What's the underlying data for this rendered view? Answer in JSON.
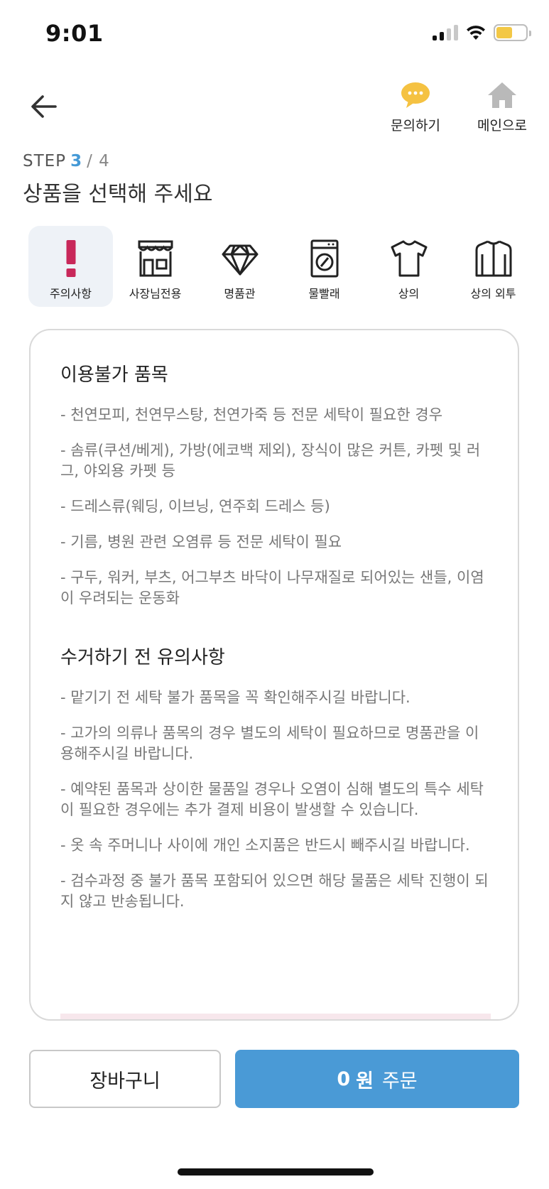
{
  "status": {
    "time": "9:01"
  },
  "nav": {
    "inquiry_label": "문의하기",
    "main_label": "메인으로"
  },
  "step": {
    "prefix": "STEP",
    "current": "3",
    "separator": "/",
    "total": "4",
    "title": "상품을 선택해 주세요"
  },
  "categories": [
    {
      "label": "주의사항",
      "icon": "exclamation-icon",
      "active": true
    },
    {
      "label": "사장님전용",
      "icon": "store-icon",
      "active": false
    },
    {
      "label": "명품관",
      "icon": "diamond-icon",
      "active": false
    },
    {
      "label": "물빨래",
      "icon": "washing-machine-icon",
      "active": false
    },
    {
      "label": "상의",
      "icon": "tshirt-icon",
      "active": false
    },
    {
      "label": "상의 외투",
      "icon": "jacket-icon",
      "active": false
    }
  ],
  "notice": {
    "unavailable": {
      "title": "이용불가 품목",
      "items": [
        "- 천연모피, 천연무스탕, 천연가죽 등 전문 세탁이 필요한 경우",
        "- 솜류(쿠션/베게), 가방(에코백 제외), 장식이 많은 커튼, 카펫 및 러그, 야외용 카펫 등",
        "- 드레스류(웨딩, 이브닝, 연주회 드레스 등)",
        "- 기름, 병원 관련 오염류 등 전문 세탁이 필요",
        "- 구두, 워커, 부츠, 어그부츠 바닥이 나무재질로 되어있는 샌들, 이염이 우려되는 운동화"
      ]
    },
    "precautions": {
      "title": "수거하기 전 유의사항",
      "items": [
        "- 맡기기 전 세탁 불가 품목을 꼭 확인해주시길 바랍니다.",
        "- 고가의 의류나 품목의 경우 별도의 세탁이 필요하므로 명품관을 이용해주시길 바랍니다.",
        "- 예약된 품목과 상이한 물품일 경우나 오염이 심해 별도의 특수 세탁이 필요한 경우에는 추가 결제 비용이 발생할 수 있습니다.",
        "- 옷 속 주머니나 사이에 개인 소지품은 반드시 빼주시길 바랍니다.",
        "- 검수과정 중 불가 품목 포함되어 있으면 해당 물품은 세탁 진행이 되지 않고 반송됩니다."
      ]
    }
  },
  "bottom": {
    "cart_label": "장바구니",
    "order_price": "0",
    "order_unit": "원",
    "order_label": "주문"
  },
  "colors": {
    "accent": "#4a9ad6",
    "warning": "#c8285a",
    "active_tab_bg": "#eef2f7",
    "chat_bubble": "#f5c242",
    "home_icon": "#b9b9b9"
  }
}
